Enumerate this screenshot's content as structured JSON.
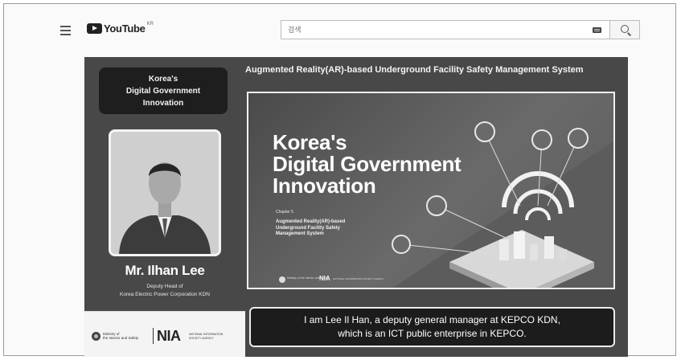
{
  "header": {
    "menu_icon": "hamburger-icon",
    "logo_text": "YouTube",
    "country_code": "KR",
    "search": {
      "placeholder": "검색"
    },
    "keyboard_icon": "keyboard-icon",
    "search_icon": "search-icon"
  },
  "video": {
    "badge": [
      "Korea's",
      "Digital Government",
      "Innovation"
    ],
    "title": "Augmented Reality(AR)-based Underground Facility Safety Management System",
    "presenter": {
      "name": "Mr. Ilhan Lee",
      "title_lines": [
        "Deputy Head of",
        "Korea Electric Power Corporation KDN"
      ]
    },
    "logos": {
      "ministry_lines": [
        "Ministry of",
        "the Interior and Safety"
      ],
      "nia_logo": "NIA",
      "nia_lines": [
        "NATIONAL INFORMATION",
        "SOCIETY AGENCY"
      ]
    },
    "slide": {
      "heading": [
        "Korea's",
        "Digital Government",
        "Innovation"
      ],
      "chapter": "Chapter 5",
      "subtitle": [
        "Augmented Reality(AR)-based",
        "Underground Facility Safety",
        "Management System"
      ],
      "footer_ministry": "Ministry of the Interior and Safety",
      "footer_nia": "NIA",
      "footer_nia_text": "NATIONAL INFORMATION SOCIETY AGENCY"
    },
    "caption": [
      "I am Lee Il Han, a deputy general manager at KEPCO KDN,",
      "which is an ICT public enterprise in KEPCO."
    ]
  }
}
